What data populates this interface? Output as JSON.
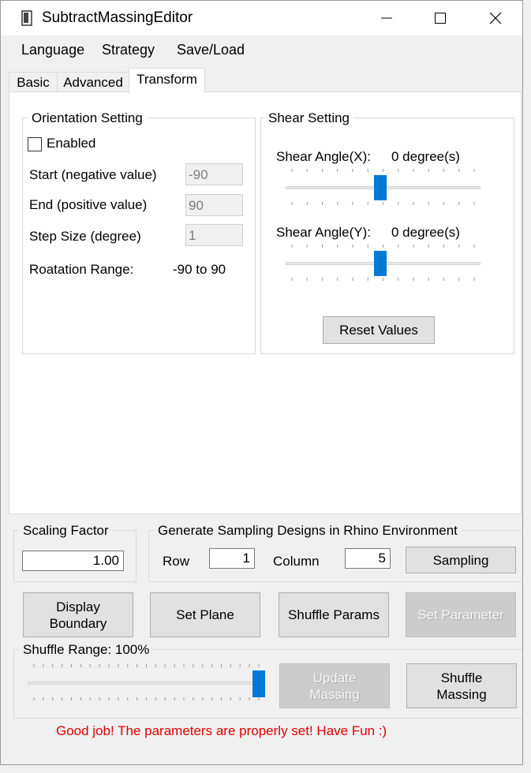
{
  "window": {
    "title": "SubtractMassingEditor"
  },
  "menu": [
    "Language",
    "Strategy",
    "Save/Load"
  ],
  "tabs": [
    {
      "label": "Basic"
    },
    {
      "label": "Advanced"
    },
    {
      "label": "Transform",
      "active": true
    }
  ],
  "orientation": {
    "group_title": "Orientation Setting",
    "enabled_label": "Enabled",
    "enabled": false,
    "start_label": "Start (negative value)",
    "start_value": "-90",
    "end_label": "End  (positive value)",
    "end_value": "90",
    "step_label": "Step Size (degree)",
    "step_value": "1",
    "range_label": "Roatation Range:",
    "range_value": "-90 to 90"
  },
  "shear": {
    "group_title": "Shear Setting",
    "x_label": "Shear Angle(X):",
    "x_value": "0 degree(s)",
    "x_slider": 0.5,
    "y_label": "Shear Angle(Y):",
    "y_value": "0 degree(s)",
    "y_slider": 0.5,
    "reset_label": "Reset Values"
  },
  "scaling": {
    "group_title": "Scaling Factor",
    "value": "1.00"
  },
  "sampling": {
    "group_title": "Generate Sampling Designs in Rhino Environment",
    "row_label": "Row",
    "row_value": "1",
    "column_label": "Column",
    "column_value": "5",
    "button_label": "Sampling"
  },
  "actions": {
    "display_boundary": "Display\nBoundary",
    "set_plane": "Set Plane",
    "shuffle_params": "Shuffle Params",
    "set_parameter": "Set Parameter"
  },
  "shuffle": {
    "range_label": "Shuffle Range: 100%",
    "slider": 1.0,
    "update_label": "Update\nMassing",
    "shuffle_label": "Shuffle\nMassing"
  },
  "status": "Good job! The parameters are properly set! Have Fun :)",
  "colors": {
    "accent": "#0078d7",
    "status": "#e00000"
  }
}
